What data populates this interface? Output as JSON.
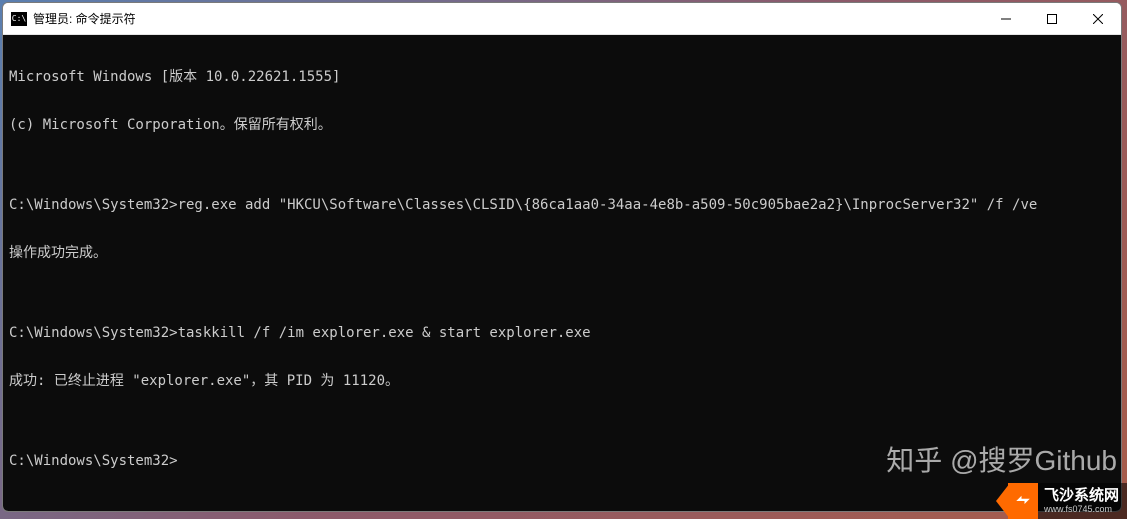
{
  "window": {
    "icon_text": "C:\\",
    "title": "管理员: 命令提示符"
  },
  "terminal": {
    "line1": "Microsoft Windows [版本 10.0.22621.1555]",
    "line2": "(c) Microsoft Corporation。保留所有权利。",
    "line3": "",
    "line4": "C:\\Windows\\System32>reg.exe add \"HKCU\\Software\\Classes\\CLSID\\{86ca1aa0-34aa-4e8b-a509-50c905bae2a2}\\InprocServer32\" /f /ve",
    "line5": "操作成功完成。",
    "line6": "",
    "line7": "C:\\Windows\\System32>taskkill /f /im explorer.exe & start explorer.exe",
    "line8": "成功: 已终止进程 \"explorer.exe\"，其 PID 为 11120。",
    "line9": "",
    "line10": "C:\\Windows\\System32>"
  },
  "watermark": {
    "zhihu": "知乎 @搜罗Github",
    "badge_title": "飞沙系统网",
    "badge_url": "www.fs0745.com"
  }
}
